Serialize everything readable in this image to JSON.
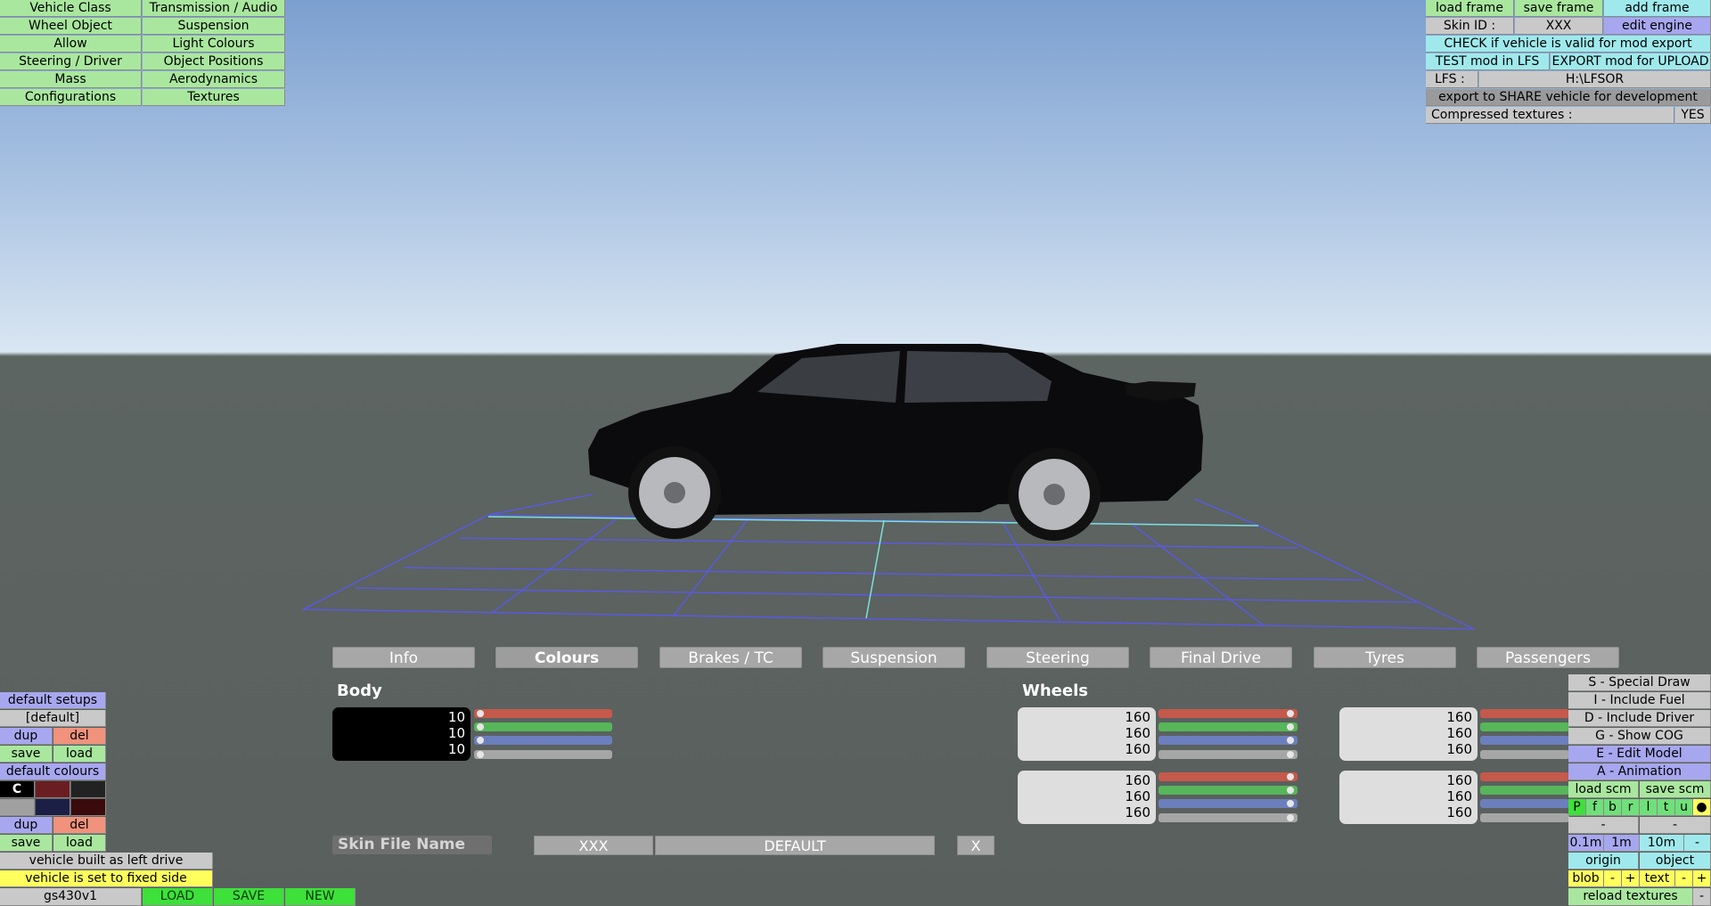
{
  "topleft_menu": [
    [
      "Vehicle Class",
      "Transmission / Audio"
    ],
    [
      "Wheel Object",
      "Suspension"
    ],
    [
      "Allow",
      "Light Colours"
    ],
    [
      "Steering / Driver",
      "Object Positions"
    ],
    [
      "Mass",
      "Aerodynamics"
    ],
    [
      "Configurations",
      "Textures"
    ]
  ],
  "topright": {
    "load_frame": "load frame",
    "save_frame": "save frame",
    "add_frame": "add frame",
    "skin_id_label": "Skin ID :",
    "skin_id_value": "XXX",
    "edit_engine": "edit engine",
    "check_valid": "CHECK if vehicle is valid for mod export",
    "test_mod": "TEST mod in LFS",
    "export_mod": "EXPORT mod for UPLOAD",
    "lfs_label": "LFS :",
    "lfs_path": "H:\\LFSOR",
    "share": "export to SHARE vehicle for development",
    "compressed_label": "Compressed textures :",
    "compressed_value": "YES"
  },
  "tabs": [
    "Info",
    "Colours",
    "Brakes / TC",
    "Suspension",
    "Steering",
    "Final Drive",
    "Tyres",
    "Passengers"
  ],
  "active_tab": "Colours",
  "body": {
    "header": "Body",
    "values": [
      "10",
      "10",
      "10"
    ]
  },
  "wheels": {
    "header": "Wheels",
    "values": [
      "160",
      "160",
      "160"
    ]
  },
  "skin": {
    "label": "Skin File Name",
    "id": "XXX",
    "name": "DEFAULT",
    "close": "X"
  },
  "bottomleft": {
    "default_setups": "default setups",
    "default_item": "[default]",
    "dup": "dup",
    "del": "del",
    "save": "save",
    "load": "load",
    "default_colours": "default colours",
    "c": "C",
    "left_drive": "vehicle built as left drive",
    "fixed_side": "vehicle is set to fixed side",
    "name": "gs430v1",
    "LOAD": "LOAD",
    "SAVE": "SAVE",
    "NEW": "NEW"
  },
  "bottomright": {
    "special_draw": "S - Special Draw",
    "include_fuel": "I - Include Fuel",
    "include_driver": "D - Include Driver",
    "show_cog": "G - Show COG",
    "edit_model": "E - Edit Model",
    "animation": "A - Animation",
    "load_scm": "load scm",
    "save_scm": "save scm",
    "letters": [
      "P",
      "f",
      "b",
      "r",
      "l",
      "t",
      "u"
    ],
    "minus": "-",
    "m01": "0.1m",
    "m1": "1m",
    "m10": "10m",
    "origin": "origin",
    "object": "object",
    "blob": "blob",
    "plus": "+",
    "text": "text",
    "reload": "reload textures"
  },
  "colors": {
    "red": "#c5594b",
    "green": "#56b659",
    "blue": "#6c7fbd",
    "grey": "#a6a6a6"
  }
}
